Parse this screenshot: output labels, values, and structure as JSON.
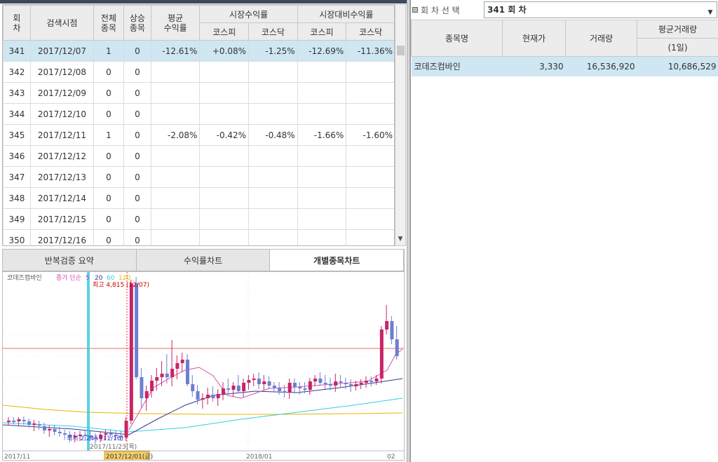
{
  "grid": {
    "headers": {
      "round": "회\n차",
      "search_date": "검색시점",
      "total": "전체\n종목",
      "up": "상승\n종목",
      "avg": "평균\n수익률",
      "market": "시장수익률",
      "relative": "시장대비수익률",
      "kospi": "코스피",
      "kosdaq": "코스닥",
      "kospi2": "코스피",
      "kosdaq2": "코스닥"
    },
    "rows": [
      {
        "round": "341",
        "date": "2017/12/07",
        "total": "1",
        "up": "0",
        "avg": "-12.61%",
        "m_kospi": "+0.08%",
        "m_kosdaq": "-1.25%",
        "r_kospi": "-12.69%",
        "r_kosdaq": "-11.36%"
      },
      {
        "round": "342",
        "date": "2017/12/08",
        "total": "0",
        "up": "0",
        "avg": "",
        "m_kospi": "",
        "m_kosdaq": "",
        "r_kospi": "",
        "r_kosdaq": ""
      },
      {
        "round": "343",
        "date": "2017/12/09",
        "total": "0",
        "up": "0",
        "avg": "",
        "m_kospi": "",
        "m_kosdaq": "",
        "r_kospi": "",
        "r_kosdaq": ""
      },
      {
        "round": "344",
        "date": "2017/12/10",
        "total": "0",
        "up": "0",
        "avg": "",
        "m_kospi": "",
        "m_kosdaq": "",
        "r_kospi": "",
        "r_kosdaq": ""
      },
      {
        "round": "345",
        "date": "2017/12/11",
        "total": "1",
        "up": "0",
        "avg": "-2.08%",
        "m_kospi": "-0.42%",
        "m_kosdaq": "-0.48%",
        "r_kospi": "-1.66%",
        "r_kosdaq": "-1.60%"
      },
      {
        "round": "346",
        "date": "2017/12/12",
        "total": "0",
        "up": "0",
        "avg": "",
        "m_kospi": "",
        "m_kosdaq": "",
        "r_kospi": "",
        "r_kosdaq": ""
      },
      {
        "round": "347",
        "date": "2017/12/13",
        "total": "0",
        "up": "0",
        "avg": "",
        "m_kospi": "",
        "m_kosdaq": "",
        "r_kospi": "",
        "r_kosdaq": ""
      },
      {
        "round": "348",
        "date": "2017/12/14",
        "total": "0",
        "up": "0",
        "avg": "",
        "m_kospi": "",
        "m_kosdaq": "",
        "r_kospi": "",
        "r_kosdaq": ""
      },
      {
        "round": "349",
        "date": "2017/12/15",
        "total": "0",
        "up": "0",
        "avg": "",
        "m_kospi": "",
        "m_kosdaq": "",
        "r_kospi": "",
        "r_kosdaq": ""
      },
      {
        "round": "350",
        "date": "2017/12/16",
        "total": "0",
        "up": "0",
        "avg": "",
        "m_kospi": "",
        "m_kosdaq": "",
        "r_kospi": "",
        "r_kosdaq": ""
      }
    ]
  },
  "tabs": [
    "반복검증 요약",
    "수익률차트",
    "개별종목차트"
  ],
  "chart": {
    "legend_name": "코데즈컴바인",
    "legend_type": "종가 단순",
    "ma": [
      "5",
      "20",
      "60",
      "120"
    ],
    "high_label": "최고 4,815 (12/07)",
    "low_label": "최저 2,245 (11/16)",
    "cursor_date": "2017/11/23(목)",
    "selected_date": "2017/12/01(금)",
    "x_labels": [
      "2017/11",
      "2018/01",
      "02"
    ]
  },
  "right": {
    "round_label": "회 차 선 택",
    "round_value": "341 회 차",
    "headers": {
      "name": "종목명",
      "price": "현재가",
      "volume": "거래량",
      "avg_volume": "평균거래량",
      "avg_sub": "(1일)"
    },
    "rows": [
      {
        "name": "코데즈컴바인",
        "price": "3,330",
        "volume": "16,536,920",
        "avg_volume": "10,686,529"
      }
    ]
  },
  "colors": {
    "selected_row": "#cfe6f3",
    "up": "#e0003c",
    "down": "#2a4fc9"
  }
}
